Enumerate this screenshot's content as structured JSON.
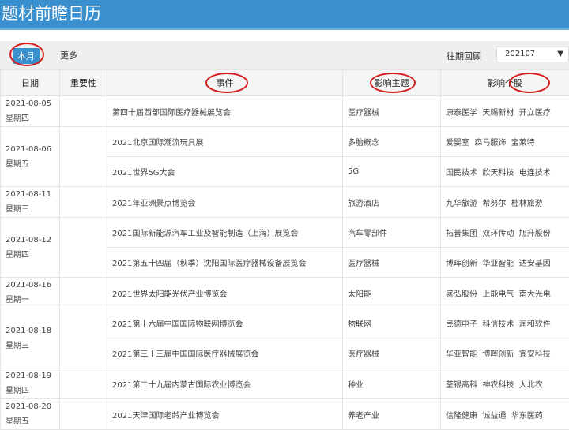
{
  "title": "题材前瞻日历",
  "toolbar": {
    "tab_current": "本月",
    "tab_more": "更多",
    "history_label": "往期回顾",
    "history_value": "202107",
    "dropdown_icon": "▼"
  },
  "columns": [
    "日期",
    "重要性",
    "事件",
    "影响主题",
    "影响个股"
  ],
  "rows": [
    {
      "date": "2021-08-05",
      "weekday": "星期四",
      "event": "第四十届西部国际医疗器械展览会",
      "theme": "医疗器械",
      "stocks": "康泰医学  天赐新材  开立医疗"
    },
    {
      "date": "2021-08-06",
      "weekday": "星期五",
      "event": "2021北京国际潮流玩具展",
      "theme": "多胎概念",
      "stocks": "爱婴室  森马服饰  宝莱特"
    },
    {
      "event": "2021世界5G大会",
      "theme": "5G",
      "stocks": "国民技术  欣天科技  电连技术"
    },
    {
      "date": "2021-08-11",
      "weekday": "星期三",
      "event": "2021年亚洲景点博览会",
      "theme": "旅游酒店",
      "stocks": "九华旅游  希努尔  桂林旅游"
    },
    {
      "date": "2021-08-12",
      "weekday": "星期四",
      "event": "2021国际新能源汽车工业及智能制造（上海）展览会",
      "theme": "汽车零部件",
      "stocks": "拓普集团  双环传动  旭升股份"
    },
    {
      "event": "2021第五十四届（秋季）沈阳国际医疗器械设备展览会",
      "theme": "医疗器械",
      "stocks": "博晖创新  华亚智能  达安基因"
    },
    {
      "date": "2021-08-16",
      "weekday": "星期一",
      "event": "2021世界太阳能光伏产业博览会",
      "theme": "太阳能",
      "stocks": "盛弘股份  上能电气  南大光电"
    },
    {
      "date": "2021-08-18",
      "weekday": "星期三",
      "event": "2021第十六届中国国际物联网博览会",
      "theme": "物联网",
      "stocks": "民德电子  科信技术  润和软件"
    },
    {
      "event": "2021第三十三届中国国际医疗器械展览会",
      "theme": "医疗器械",
      "stocks": "华亚智能  博晖创新  宜安科技"
    },
    {
      "date": "2021-08-19",
      "weekday": "星期四",
      "event": "2021第二十九届内蒙古国际农业博览会",
      "theme": "种业",
      "stocks": "荃银高科  神农科技  大北农"
    },
    {
      "date": "2021-08-20",
      "weekday": "星期五",
      "event": "2021天津国际老龄产业博览会",
      "theme": "养老产业",
      "stocks": "信隆健康  诚益通  华东医药"
    }
  ]
}
